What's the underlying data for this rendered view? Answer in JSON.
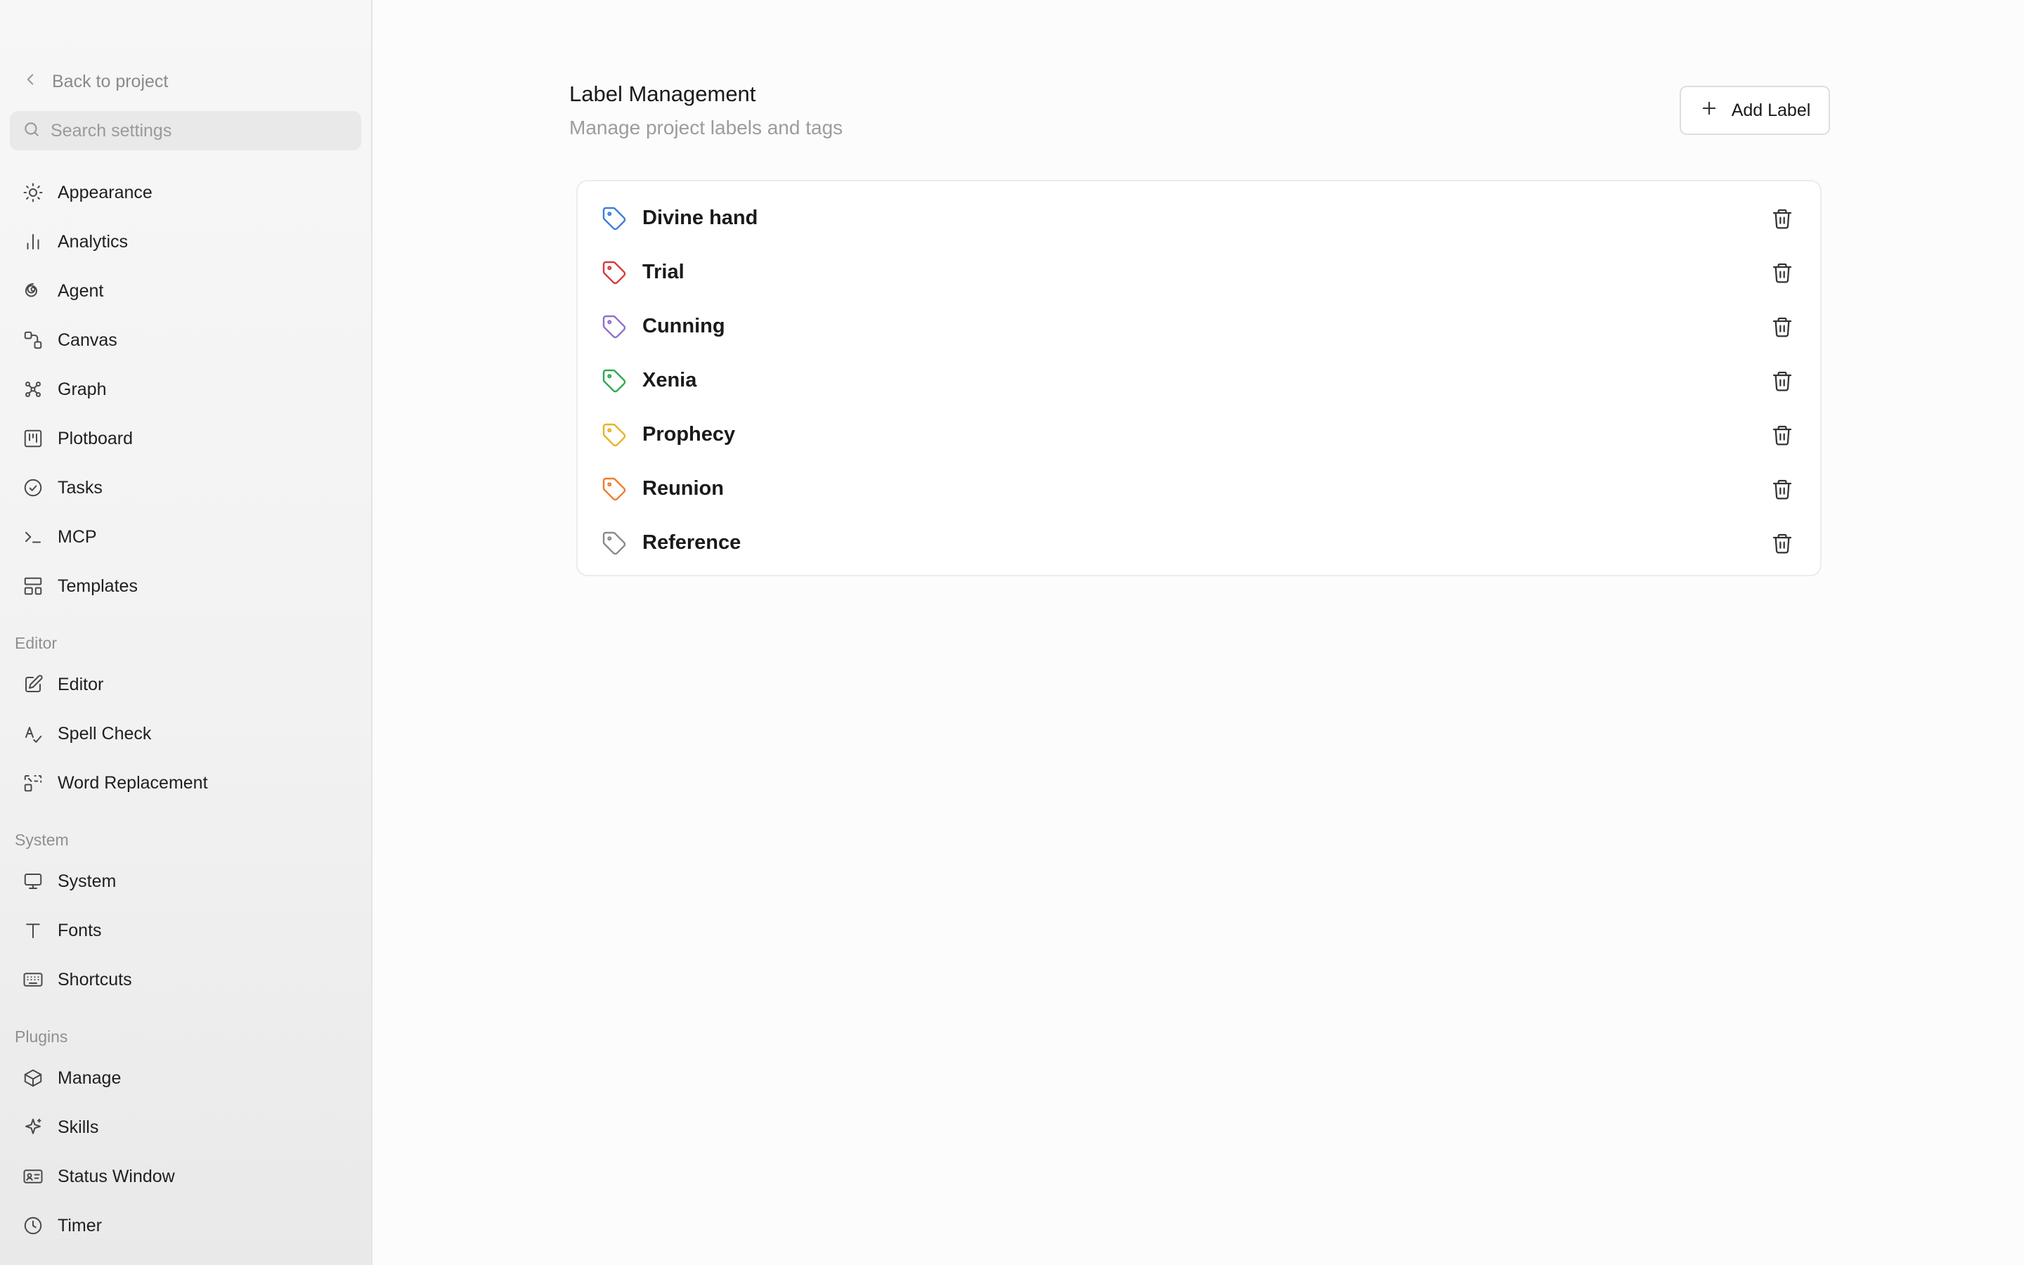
{
  "sidebar": {
    "back_label": "Back to project",
    "search_placeholder": "Search settings",
    "general_items": [
      {
        "label": "Appearance",
        "icon": "sun-icon"
      },
      {
        "label": "Analytics",
        "icon": "bar-chart-icon"
      },
      {
        "label": "Agent",
        "icon": "spiral-icon"
      },
      {
        "label": "Canvas",
        "icon": "shapes-icon"
      },
      {
        "label": "Graph",
        "icon": "graph-nodes-icon"
      },
      {
        "label": "Plotboard",
        "icon": "kanban-icon"
      },
      {
        "label": "Tasks",
        "icon": "check-circle-icon"
      },
      {
        "label": "MCP",
        "icon": "terminal-icon"
      },
      {
        "label": "Templates",
        "icon": "layout-template-icon"
      }
    ],
    "editor_section": "Editor",
    "editor_items": [
      {
        "label": "Editor",
        "icon": "edit-icon"
      },
      {
        "label": "Spell Check",
        "icon": "spell-check-icon"
      },
      {
        "label": "Word Replacement",
        "icon": "replace-icon"
      }
    ],
    "system_section": "System",
    "system_items": [
      {
        "label": "System",
        "icon": "monitor-icon"
      },
      {
        "label": "Fonts",
        "icon": "type-icon"
      },
      {
        "label": "Shortcuts",
        "icon": "keyboard-icon"
      }
    ],
    "plugins_section": "Plugins",
    "plugins_items": [
      {
        "label": "Manage",
        "icon": "package-icon"
      },
      {
        "label": "Skills",
        "icon": "sparkle-icon"
      },
      {
        "label": "Status Window",
        "icon": "id-card-icon"
      },
      {
        "label": "Timer",
        "icon": "clock-icon"
      }
    ]
  },
  "main": {
    "title": "Label Management",
    "subtitle": "Manage project labels and tags",
    "add_button_label": "Add Label",
    "labels": [
      {
        "name": "Divine hand",
        "color": "#3b7ddd"
      },
      {
        "name": "Trial",
        "color": "#d63a3a"
      },
      {
        "name": "Cunning",
        "color": "#8e6fd1"
      },
      {
        "name": "Xenia",
        "color": "#2ea84f"
      },
      {
        "name": "Prophecy",
        "color": "#e6b422"
      },
      {
        "name": "Reunion",
        "color": "#ee7d2b"
      },
      {
        "name": "Reference",
        "color": "#8a8a8a"
      }
    ]
  }
}
